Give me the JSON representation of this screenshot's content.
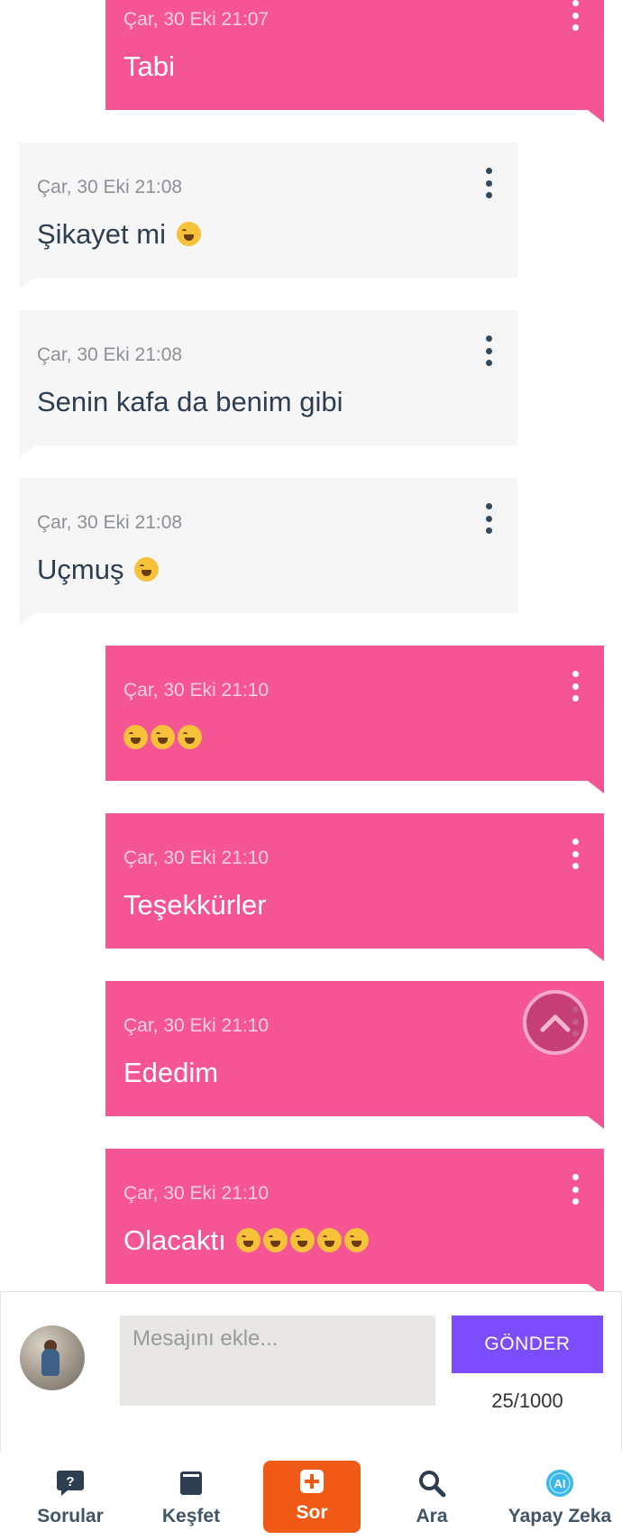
{
  "messages": [
    {
      "side": "mine",
      "time": "Çar, 30 Eki 21:07",
      "text": "Tabi",
      "emoji_count": 0
    },
    {
      "side": "theirs",
      "time": "Çar, 30 Eki 21:08",
      "text": "Şikayet mi",
      "emoji_count": 1
    },
    {
      "side": "theirs",
      "time": "Çar, 30 Eki 21:08",
      "text": "Senin kafa da benim gibi",
      "emoji_count": 0
    },
    {
      "side": "theirs",
      "time": "Çar, 30 Eki 21:08",
      "text": "Uçmuş",
      "emoji_count": 1
    },
    {
      "side": "mine",
      "time": "Çar, 30 Eki 21:10",
      "text": "",
      "emoji_count": 3
    },
    {
      "side": "mine",
      "time": "Çar, 30 Eki 21:10",
      "text": "Teşekkürler",
      "emoji_count": 0
    },
    {
      "side": "mine",
      "time": "Çar, 30 Eki 21:10",
      "text": "Ededim",
      "emoji_count": 0
    },
    {
      "side": "mine",
      "time": "Çar, 30 Eki 21:10",
      "text": "Olacaktı",
      "emoji_count": 5
    }
  ],
  "composer": {
    "placeholder": "Mesajını ekle...",
    "send_label": "GÖNDER",
    "counter": "25/1000"
  },
  "tabs": [
    {
      "label": "Sorular",
      "icon": "question-bubble-icon"
    },
    {
      "label": "Keşfet",
      "icon": "book-icon"
    },
    {
      "label": "Sor",
      "icon": "plus-icon",
      "active": true
    },
    {
      "label": "Ara",
      "icon": "search-icon"
    },
    {
      "label": "Yapay Zeka",
      "icon": "ai-icon"
    }
  ],
  "colors": {
    "my_bubble": "#f65594",
    "their_bubble": "#f6f6f6",
    "send_button": "#7c4dff",
    "active_tab": "#f15a16"
  }
}
